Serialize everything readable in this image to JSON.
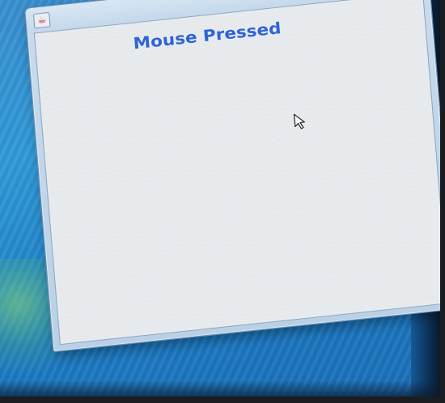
{
  "window": {
    "title": "",
    "controls": {
      "minimize_icon": "minimize-icon",
      "maximize_icon": "maximize-icon",
      "close_icon": "close-icon",
      "close_glyph": "✕"
    }
  },
  "content": {
    "status_text": "Mouse Pressed",
    "status_color": "#2f63d6"
  },
  "colors": {
    "desktop_blue": "#2f9ad8",
    "titlebar": "#c4d8eb",
    "close_red": "#c8412b",
    "client_bg": "#e8ecef"
  }
}
